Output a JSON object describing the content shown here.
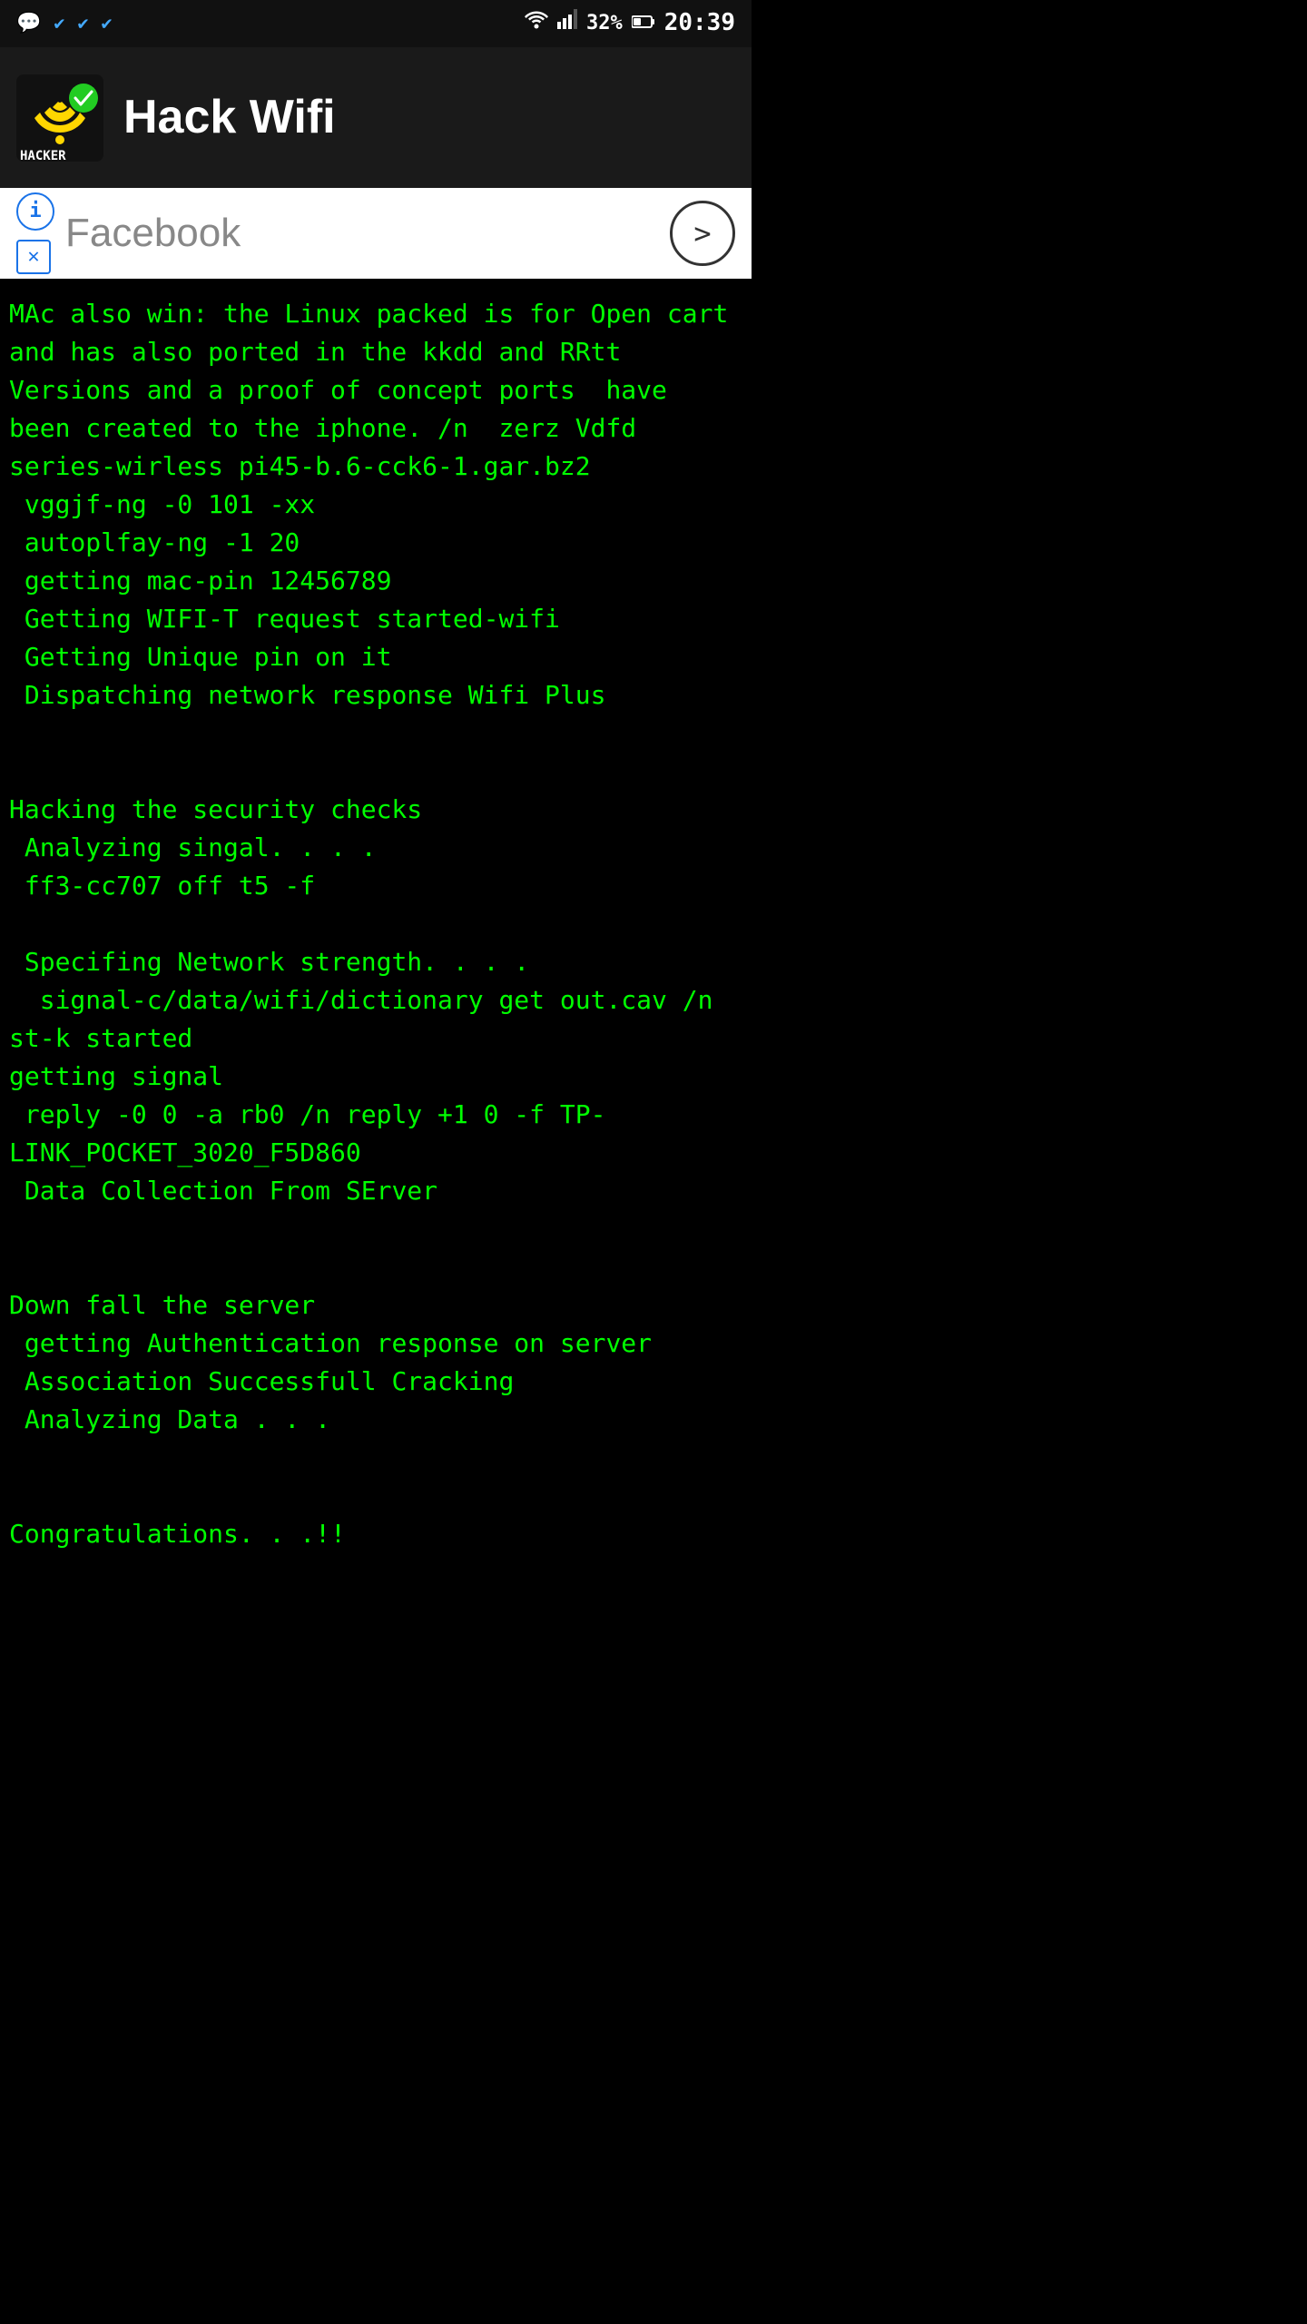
{
  "statusBar": {
    "time": "20:39",
    "battery": "32%",
    "icons": [
      "messenger",
      "check1",
      "check2",
      "check3"
    ]
  },
  "appBar": {
    "title": "Hack Wifi"
  },
  "adBanner": {
    "facebookText": "Facebook",
    "arrowLabel": ">"
  },
  "terminal": {
    "lines": [
      "MAc also win: the Linux packed is for Open cart and has also ported in the kkdd and RRtt Versions and a proof of concept ports  have been created to the iphone. /n  zerz Vdfd series-wirless pi45-b.6-cck6-1.gar.bz2",
      " vggjf-ng -0 101 -xx",
      " autoplfay-ng -1 20",
      " getting mac-pin 12456789",
      " Getting WIFI-T request started-wifi",
      " Getting Unique pin on it",
      " Dispatching network response Wifi Plus",
      "",
      "",
      "Hacking the security checks",
      " Analyzing singal. . . .",
      " ff3-cc707 off t5 -f",
      "",
      " Specifing Network strength. . . .",
      "  signal-c/data/wifi/dictionary get out.cav /n st-k started",
      "getting signal",
      " reply -0 0 -a rb0 /n reply +1 0 -f TP-LINK_POCKET_3020_F5D860",
      " Data Collection From SErver",
      "",
      "",
      "Down fall the server",
      " getting Authentication response on server",
      " Association Successfull Cracking",
      " Analyzing Data . . .",
      "",
      "",
      "Congratulations. . .!!"
    ]
  }
}
